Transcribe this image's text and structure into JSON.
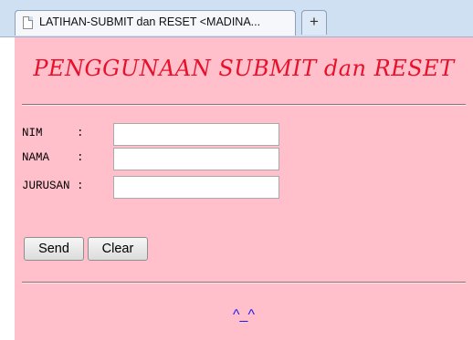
{
  "browser": {
    "tab_title": "LATIHAN-SUBMIT dan RESET <MADINA...",
    "new_tab_symbol": "+",
    "tab_icon": "page-icon",
    "new_tab_icon": "plus-icon"
  },
  "page": {
    "heading": "PENGGUNAAN SUBMIT dan RESET",
    "background_color": "#ffc0cb",
    "heading_color": "#e8102a",
    "footer_text": "^_^",
    "footer_color": "#1d1df0"
  },
  "form": {
    "fields": [
      {
        "label": "NIM     :",
        "value": ""
      },
      {
        "label": "NAMA    :",
        "value": ""
      },
      {
        "label": "JURUSAN :",
        "value": ""
      }
    ],
    "submit_label": "Send",
    "reset_label": "Clear"
  }
}
